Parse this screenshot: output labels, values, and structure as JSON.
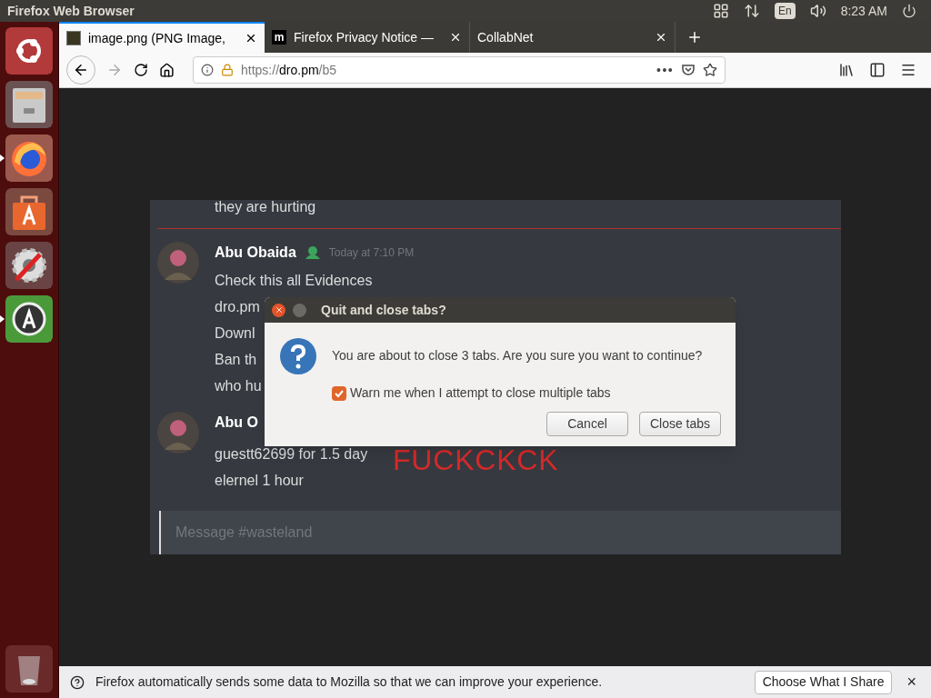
{
  "top_bar": {
    "title": "Firefox Web Browser",
    "keyboard": "En",
    "clock": "8:23 AM"
  },
  "launcher": {
    "items": [
      {
        "kind": "ubuntu",
        "running": false
      },
      {
        "kind": "files",
        "running": false
      },
      {
        "kind": "firefox",
        "running": true
      },
      {
        "kind": "store",
        "running": false
      },
      {
        "kind": "settings",
        "running": false
      },
      {
        "kind": "updater",
        "running": true
      }
    ]
  },
  "tabs": [
    {
      "label": "image.png (PNG Image,",
      "selected": true,
      "kind": "image"
    },
    {
      "label": "Firefox Privacy Notice —",
      "selected": false,
      "kind": "letter",
      "icon_letter": "m"
    },
    {
      "label": "CollabNet",
      "selected": false,
      "kind": "plain"
    }
  ],
  "url": {
    "prefix": "https://",
    "host": "dro.pm",
    "path": "/b5",
    "more": "•••"
  },
  "chat": {
    "top_line": "they are hurting",
    "messages": [
      {
        "author": "Abu Obaida",
        "time": "Today at 7:10 PM",
        "lines": [
          "Check this all Evidences",
          "dro.pm",
          "Downl",
          "Ban th",
          "who hu"
        ]
      },
      {
        "author": "Abu O",
        "lines": [
          "guestt62699 for 1.5 day",
          "elernel 1 hour"
        ]
      }
    ],
    "overlay_text": "FUCKCKCK",
    "input_placeholder": "Message #wasteland"
  },
  "dialog": {
    "title": "Quit and close tabs?",
    "message": "You are about to close 3 tabs. Are you sure you want to continue?",
    "checkbox": {
      "label": "Warn me when I attempt to close multiple tabs",
      "checked": true
    },
    "buttons": [
      "Cancel",
      "Close tabs"
    ]
  },
  "notification": {
    "text": "Firefox automatically sends some data to Mozilla so that we can improve your experience.",
    "button": "Choose What I Share",
    "close": "×"
  }
}
